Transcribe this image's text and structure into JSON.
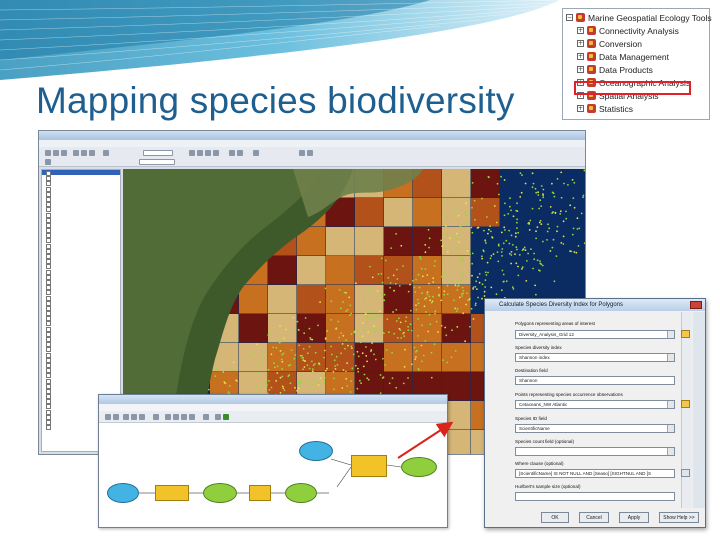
{
  "slide": {
    "title": "Mapping species biodiversity"
  },
  "toolbox": {
    "items": [
      {
        "label": "Marine Geospatial Ecology Tools"
      },
      {
        "label": "Connectivity Analysis"
      },
      {
        "label": "Conversion"
      },
      {
        "label": "Data Management"
      },
      {
        "label": "Data Products"
      },
      {
        "label": "Oceanographic Analysis"
      },
      {
        "label": "Spatial Analysis"
      },
      {
        "label": "Statistics"
      }
    ],
    "highlight_color": "#e0212a"
  },
  "dialog": {
    "title": "Calculate Species Diversity Index for Polygons",
    "fields": [
      {
        "label": "Polygons representing areas of interest",
        "value": "Diversity_Analysis_Grid 12",
        "folder": true
      },
      {
        "label": "Species diversity index",
        "value": "Shannon index",
        "folder": false
      },
      {
        "label": "Destination field",
        "value": "Shannon",
        "folder": false
      },
      {
        "label": "Points representing species occurrence observations",
        "value": "Cetaceans_NW Atlantic",
        "folder": true
      },
      {
        "label": "Species ID field",
        "value": "ScientificName",
        "folder": false
      },
      {
        "label": "Species count field (optional)",
        "value": "",
        "folder": false
      },
      {
        "label": "Where clause (optional)",
        "value": "[ScientificName] IS NOT NULL AND [Seaso] [SIGHTNUL AND [S",
        "folder": false
      },
      {
        "label": "Hurlbert's sample size (optional)",
        "value": "",
        "folder": false
      }
    ],
    "buttons": {
      "ok": "OK",
      "cancel": "Cancel",
      "apply": "Apply",
      "help": "Show Help >>"
    }
  },
  "colors": {
    "title_blue": "#1f5f8f",
    "ocean": "#0b2c63",
    "grid_dark": "#7a1205",
    "grid_orange": "#e07a17",
    "grid_light": "#f3c97a",
    "points_green": "#8fdc3a",
    "arrow_red": "#d9231b"
  }
}
